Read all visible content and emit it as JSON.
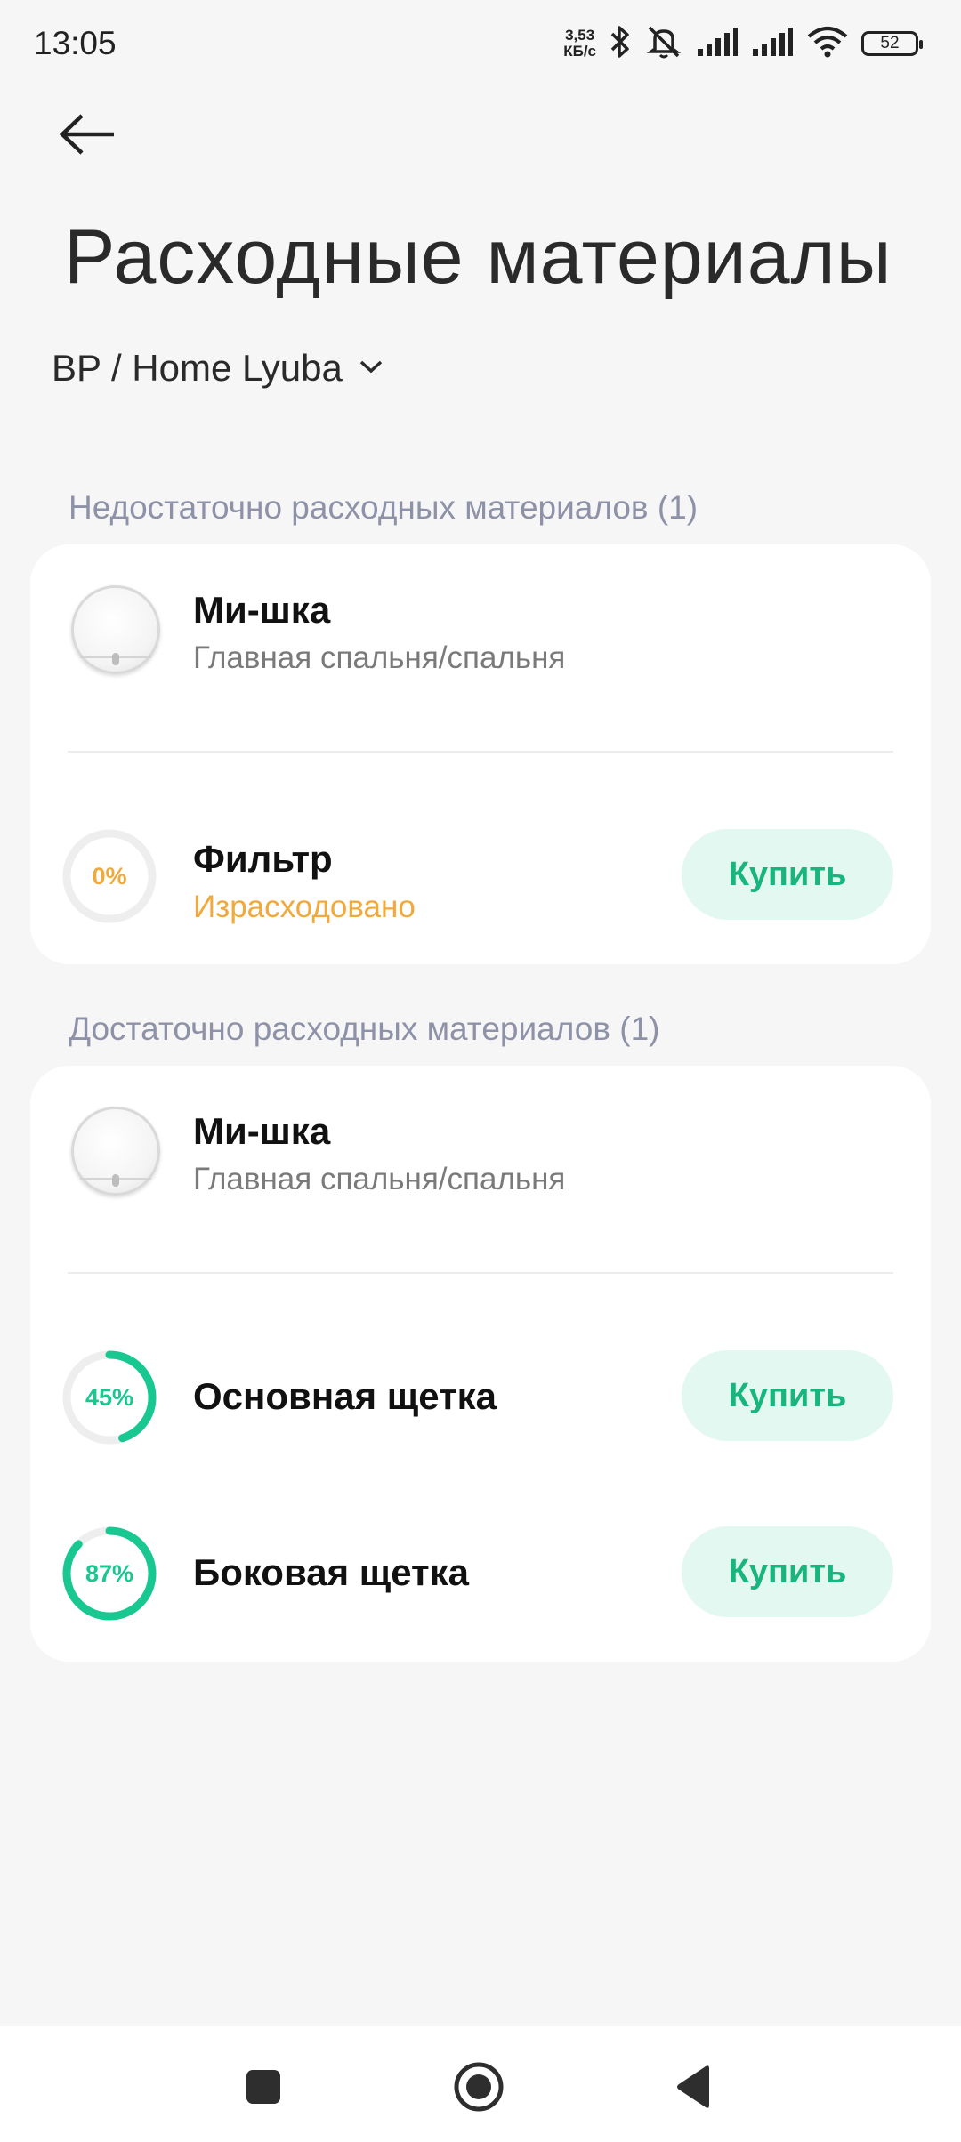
{
  "status_bar": {
    "time": "13:05",
    "net_speed_value": "3,53",
    "net_speed_unit": "КБ/с",
    "battery": "52",
    "icons": [
      "bluetooth-icon",
      "mute-icon",
      "signal-icon",
      "signal-icon",
      "wifi-icon",
      "battery-icon"
    ]
  },
  "header": {
    "back_icon": "arrow-left-icon",
    "title": "Расходные материалы",
    "home_selector": "BP / Home Lyuba",
    "chevron_icon": "chevron-down-icon"
  },
  "sections": [
    {
      "header": "Недостаточно расходных материалов (1)",
      "device": {
        "name": "Ми-шка",
        "room": "Главная спальня/спальня"
      },
      "items": [
        {
          "name": "Фильтр",
          "percent_label": "0%",
          "percent": 0,
          "status": "Израсходовано",
          "buy_label": "Купить",
          "color": "#f0a93b"
        }
      ]
    },
    {
      "header": "Достаточно расходных материалов (1)",
      "device": {
        "name": "Ми-шка",
        "room": "Главная спальня/спальня"
      },
      "items": [
        {
          "name": "Основная щетка",
          "percent_label": "45%",
          "percent": 45,
          "buy_label": "Купить",
          "color": "#19c891"
        },
        {
          "name": "Боковая щетка",
          "percent_label": "87%",
          "percent": 87,
          "buy_label": "Купить",
          "color": "#19c891"
        }
      ]
    }
  ],
  "colors": {
    "accent": "#19c891",
    "warning": "#f0a93b",
    "button_bg": "#e3f8f0",
    "section_header": "#8e92a8"
  },
  "nav_bar": {
    "icons": [
      "recents-square-icon",
      "home-circle-icon",
      "back-triangle-icon"
    ]
  }
}
